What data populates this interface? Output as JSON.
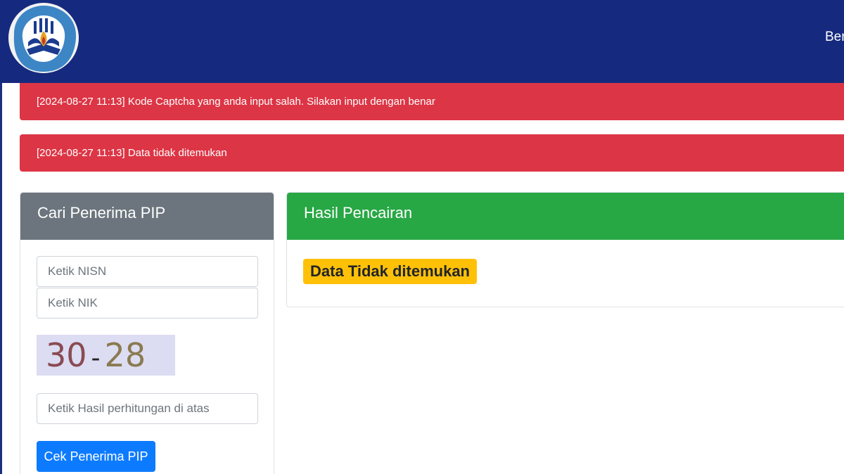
{
  "header": {
    "logo_alt": "Tut Wuri Handayani",
    "nav_link_label": "Ber"
  },
  "alerts": [
    {
      "text": "[2024-08-27 11:13] Kode Captcha yang anda input salah. Silakan input dengan benar"
    },
    {
      "text": "[2024-08-27 11:13] Data tidak ditemukan"
    }
  ],
  "search_card": {
    "title": "Cari Penerima PIP",
    "nisn_placeholder": "Ketik NISN",
    "nik_placeholder": "Ketik NIK",
    "captcha": {
      "left": "30",
      "operator": "-",
      "right": "28"
    },
    "answer_placeholder": "Ketik Hasil perhitungan di atas",
    "submit_label": "Cek Penerima PIP"
  },
  "result_card": {
    "title": "Hasil Pencairan",
    "message": "Data Tidak ditemukan"
  },
  "colors": {
    "navbar": "#152a7e",
    "alert_danger": "#dc3545",
    "search_header": "#6c757d",
    "result_header": "#28a745",
    "primary_button": "#0d7bff",
    "warning_badge": "#ffc107"
  }
}
